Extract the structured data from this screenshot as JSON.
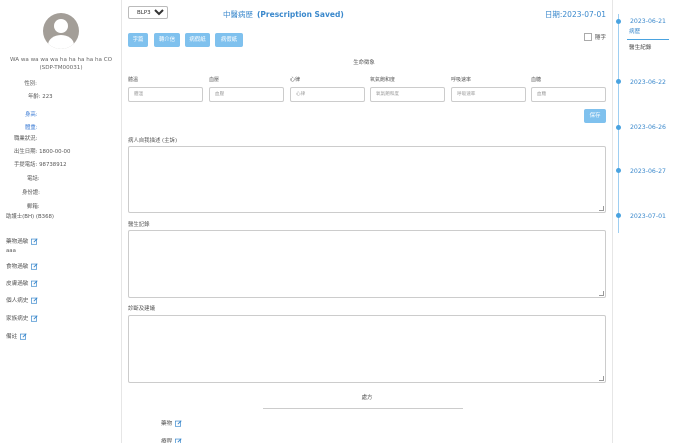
{
  "patient": {
    "name": "WA wa wa wa wa ha ha ha ha ha CO",
    "id": "(SDP-TM00031)",
    "fields": [
      {
        "label": "性別:",
        "value": "",
        "style": "r"
      },
      {
        "label": "年齡: 223",
        "value": "",
        "style": "r"
      },
      {
        "label": "身高:",
        "value": "",
        "style": "r blue"
      },
      {
        "label": "體重:",
        "value": "",
        "style": "r blue"
      },
      {
        "label": "職業狀況:",
        "value": "",
        "style": "r"
      },
      {
        "label": "出生日期: 1800-00-00",
        "value": "",
        "style": "l"
      },
      {
        "label": "手提電話: 98738912",
        "value": "",
        "style": "l"
      },
      {
        "label": "電話:",
        "value": "",
        "style": "r"
      },
      {
        "label": "身份證:",
        "value": "",
        "style": "r"
      },
      {
        "label": "郵箱:",
        "value": "",
        "style": "r"
      }
    ],
    "nurse": "助護士(BH) (B368)"
  },
  "sidebar_sections": {
    "drug_allergy": "藥物過敏",
    "drug_allergy_value": "aaa",
    "food_allergy": "食物過敏",
    "skin_allergy": "皮膚過敏",
    "personal_history": "個人病史",
    "family_history": "家族病史",
    "remarks": "備註"
  },
  "main": {
    "doctor_select": "BLP37",
    "title_cn": "中醫病歷",
    "title_status": "(Prescription Saved)",
    "date": "日期:2023-07-01",
    "buttons": [
      "字篇",
      "轉介信",
      "病假紙",
      "病假紙"
    ],
    "hide_label": "隱字",
    "vitals_title": "生命徵象",
    "vitals": [
      {
        "label": "體溫",
        "placeholder": "體溫"
      },
      {
        "label": "血壓",
        "placeholder": "血壓"
      },
      {
        "label": "心律",
        "placeholder": "心律"
      },
      {
        "label": "氧氣飽和度",
        "placeholder": "氧氣飽和度"
      },
      {
        "label": "呼吸速率",
        "placeholder": "呼吸速率"
      },
      {
        "label": "血糖",
        "placeholder": "血糖"
      }
    ],
    "save_label": "保存",
    "complaint_label": "病人自我描述 (主訴)",
    "doctor_notes_label": "醫生記錄",
    "diagnosis_label": "診斷及建議",
    "rx_title": "處方",
    "rx_items": [
      "藥物",
      "療程"
    ]
  },
  "timeline": {
    "entries": [
      {
        "date": "2023-06-21",
        "tab": "病歷",
        "sub": "醫生紀錄"
      },
      {
        "date": "2023-06-22",
        "tab": "",
        "sub": ""
      },
      {
        "date": "2023-06-26",
        "tab": "",
        "sub": ""
      },
      {
        "date": "2023-06-27",
        "tab": "",
        "sub": ""
      },
      {
        "date": "2023-07-01",
        "tab": "",
        "sub": ""
      }
    ]
  },
  "colors": {
    "accent": "#3a88cc",
    "button": "#7fc1ee",
    "timeline": "#4aa3e0"
  }
}
